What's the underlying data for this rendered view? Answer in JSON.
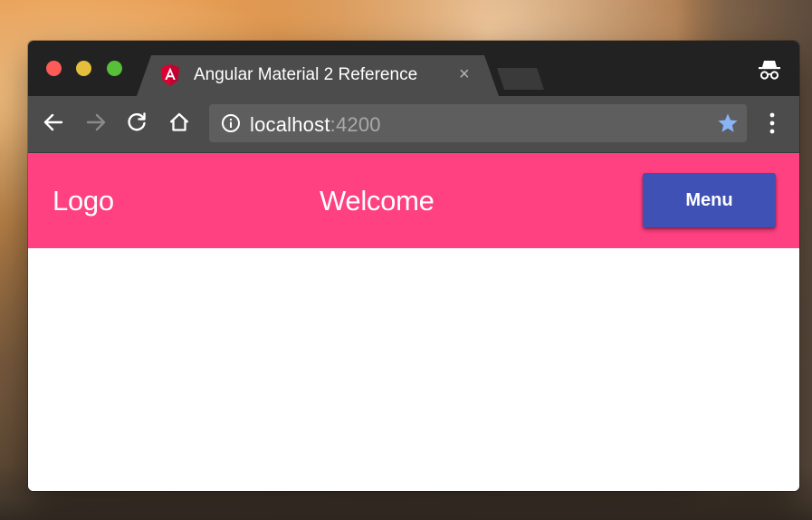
{
  "browser": {
    "tab": {
      "title": "Angular Material 2 Reference",
      "close_glyph": "×",
      "favicon": "angular-icon"
    },
    "address_bar": {
      "host": "localhost",
      "port": ":4200"
    },
    "icons": {
      "back": "arrow-left-icon",
      "forward": "arrow-right-icon",
      "reload": "reload-icon",
      "home": "home-icon",
      "info": "info-icon",
      "bookmark": "star-icon",
      "menu": "kebab-menu-icon",
      "incognito": "incognito-icon"
    },
    "colors": {
      "titlebar": "#222222",
      "toolbar": "#4c4c4c",
      "omnibox": "#5e5e5e",
      "star": "#8ab4f8"
    }
  },
  "app": {
    "toolbar": {
      "logo": "Logo",
      "title": "Welcome",
      "menu_label": "Menu"
    },
    "colors": {
      "toolbar_bg": "#ff4081",
      "menu_button_bg": "#3f51b5",
      "text": "#ffffff"
    }
  }
}
